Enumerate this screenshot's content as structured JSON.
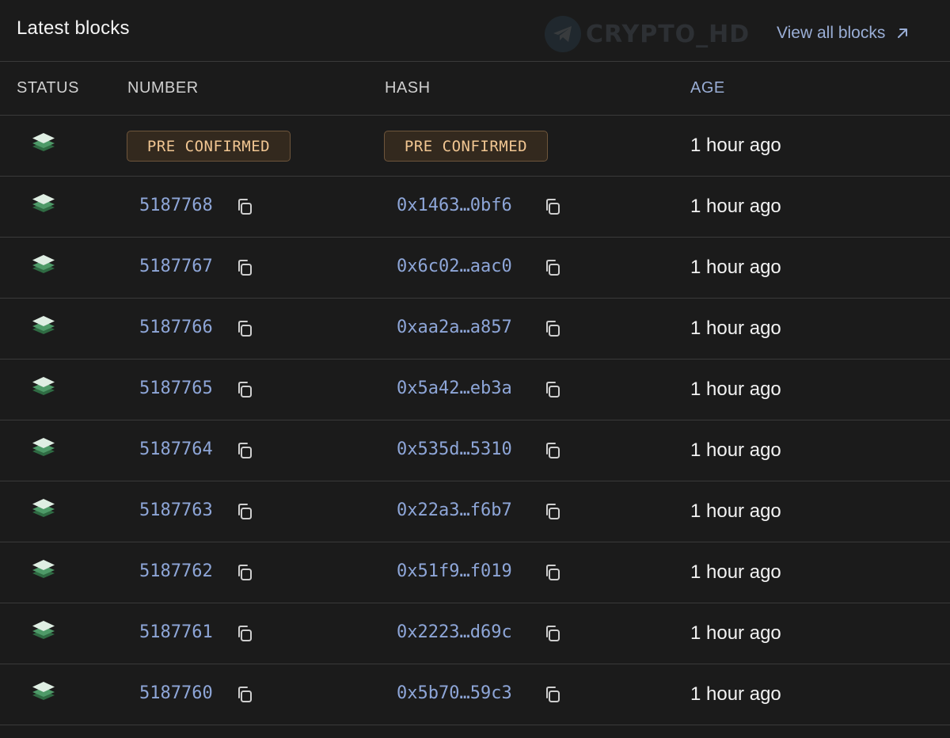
{
  "header": {
    "title": "Latest blocks",
    "watermark_text": "CRYPTO_HD",
    "view_all_label": "View all blocks"
  },
  "columns": {
    "status": "STATUS",
    "number": "NUMBER",
    "hash": "HASH",
    "age": "AGE"
  },
  "pending_row": {
    "number_badge": "PRE CONFIRMED",
    "hash_badge": "PRE CONFIRMED",
    "age": "1 hour ago"
  },
  "rows": [
    {
      "number": "5187768",
      "hash": "0x1463…0bf6",
      "age": "1 hour ago"
    },
    {
      "number": "5187767",
      "hash": "0x6c02…aac0",
      "age": "1 hour ago"
    },
    {
      "number": "5187766",
      "hash": "0xaa2a…a857",
      "age": "1 hour ago"
    },
    {
      "number": "5187765",
      "hash": "0x5a42…eb3a",
      "age": "1 hour ago"
    },
    {
      "number": "5187764",
      "hash": "0x535d…5310",
      "age": "1 hour ago"
    },
    {
      "number": "5187763",
      "hash": "0x22a3…f6b7",
      "age": "1 hour ago"
    },
    {
      "number": "5187762",
      "hash": "0x51f9…f019",
      "age": "1 hour ago"
    },
    {
      "number": "5187761",
      "hash": "0x2223…d69c",
      "age": "1 hour ago"
    },
    {
      "number": "5187760",
      "hash": "0x5b70…59c3",
      "age": "1 hour ago"
    }
  ],
  "icons": {
    "status": "layers-icon",
    "copy": "copy-icon",
    "view_all": "arrow-up-right-icon",
    "watermark": "telegram-icon"
  },
  "colors": {
    "background": "#1b1b1b",
    "link": "#8ea6d8",
    "badge_text": "#f1c692",
    "badge_bg": "#33291e",
    "status_green": "#4e9a68"
  }
}
